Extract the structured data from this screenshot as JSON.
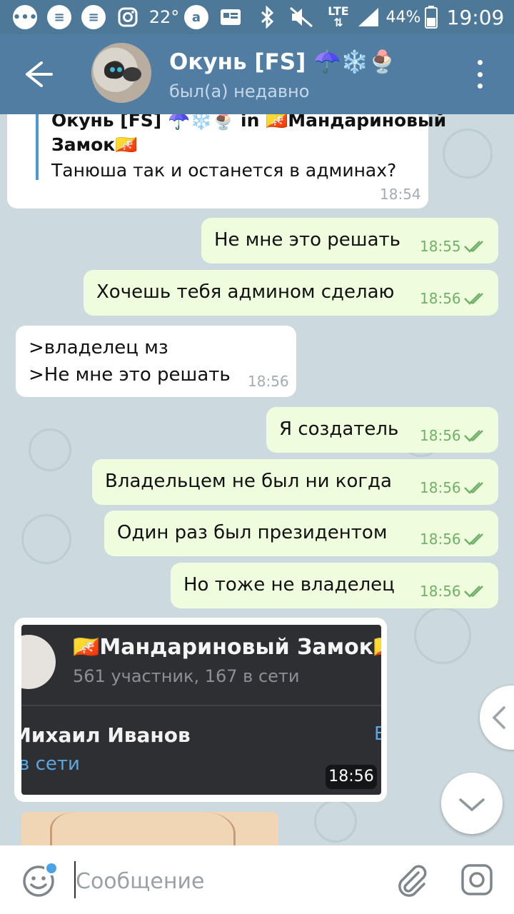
{
  "status_bar": {
    "temperature": "22°",
    "network": "LTE",
    "battery": "44%",
    "time": "19:09"
  },
  "header": {
    "title": "Окунь [FS] ☂️❄️🍨",
    "status": "был(а) недавно"
  },
  "messages": [
    {
      "direction": "in",
      "reply_name": "Окунь [FS] ☂️❄️🍨 in 🇧🇹Мандариновый",
      "reply_name_2": "Замок🇧🇹",
      "text": "Танюша так и останется в админах?",
      "time": "18:54"
    },
    {
      "direction": "out",
      "text": "Не мне это решать",
      "time": "18:55"
    },
    {
      "direction": "out",
      "text": "Хочешь тебя админом сделаю",
      "time": "18:56"
    },
    {
      "direction": "in",
      "text_1": ">владелец мз",
      "text_2": ">Не мне это решать",
      "time": "18:56"
    },
    {
      "direction": "out",
      "text": "Я создатель",
      "time": "18:56"
    },
    {
      "direction": "out",
      "text": "Владельцем не был ни когда",
      "time": "18:56"
    },
    {
      "direction": "out",
      "text": "Один раз был президентом",
      "time": "18:56"
    },
    {
      "direction": "out",
      "text": "Но тоже не владелец",
      "time": "18:56"
    },
    {
      "direction": "in",
      "type": "photo",
      "group_title": "🇧🇹Мандариновый Замок🇧🇹",
      "group_sub": "561 участник, 167 в сети",
      "person_name": "Михаил Иванов",
      "person_status": "в сети",
      "edge_letter": "В",
      "time": "18:56"
    }
  ],
  "input": {
    "placeholder": "Сообщение"
  }
}
